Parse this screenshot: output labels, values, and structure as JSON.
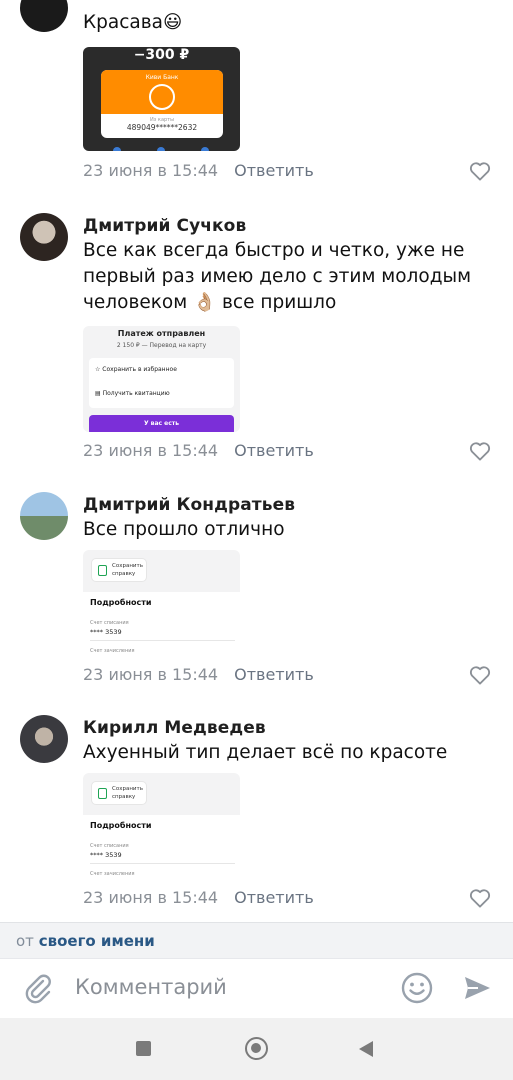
{
  "comments": [
    {
      "author": "",
      "text": "Красава",
      "emoji": "😃",
      "attachment": {
        "amount": "−300 ₽",
        "bank": "Киви Банк",
        "label": "Из карты",
        "card": "489049******2632"
      },
      "date": "23 июня в 15:44",
      "reply": "Ответить"
    },
    {
      "author": "Дмитрий Сучков",
      "text_lines": [
        "Все как всегда быстро и четко, уже не",
        "первый раз имею дело с этим молодым",
        "человеком",
        "все пришло"
      ],
      "emoji": "👌🏼",
      "attachment": {
        "title": "Платеж отправлен",
        "subtitle": "2 150 ₽ — Перевод на карту",
        "row1": "Сохранить в избранное",
        "row2": "Получить квитанцию",
        "banner": "У вас есть"
      },
      "date": "23 июня в 15:44",
      "reply": "Ответить"
    },
    {
      "author": "Дмитрий Кондратьев",
      "text": "Все прошло отлично",
      "attachment": {
        "save_line1": "Сохранить",
        "save_line2": "справку",
        "details": "Подробности",
        "account_from": "Счет списания",
        "account_num": "**** 3539",
        "account_to": "Счет зачисления"
      },
      "date": "23 июня в 15:44",
      "reply": "Ответить"
    },
    {
      "author": "Кирилл Медведев",
      "text": "Ахуенный тип делает всё по красоте",
      "attachment": {
        "save_line1": "Сохранить",
        "save_line2": "справку",
        "details": "Подробности",
        "account_from": "Счет списания",
        "account_num": "**** 3539",
        "account_to": "Счет зачисления"
      },
      "date": "23 июня в 15:44",
      "reply": "Ответить"
    }
  ],
  "from_bar": {
    "prefix": "от",
    "link": "своего имени"
  },
  "composer": {
    "placeholder": "Комментарий"
  },
  "icons": {
    "attach": "paperclip-icon",
    "emoji": "smile-icon",
    "send": "send-icon",
    "like": "heart-icon",
    "nav_recent": "square-icon",
    "nav_home": "circle-icon",
    "nav_back": "triangle-back-icon"
  },
  "colors": {
    "accent": "#2a5885",
    "qiwi_orange": "#ff8c00",
    "purple_banner": "#7b2fd8",
    "muted": "#8a8f96"
  }
}
